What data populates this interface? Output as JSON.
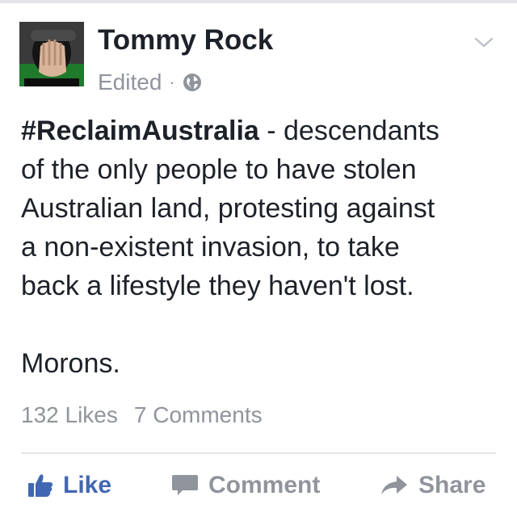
{
  "post": {
    "author": "Tommy Rock",
    "status": "Edited",
    "separator": "·",
    "privacy_icon": "globe-icon",
    "options_icon": "chevron-down-icon",
    "hashtag": "#ReclaimAustralia",
    "body_lines": [
      " - descendants",
      "of the only people to have stolen",
      "Australian land, protesting against",
      "a non-existent invasion, to take",
      "back a lifestyle they haven't lost."
    ],
    "closing": "Morons."
  },
  "stats": {
    "likes": "132 Likes",
    "comments": "7 Comments"
  },
  "actions": {
    "like_label": "Like",
    "comment_label": "Comment",
    "share_label": "Share"
  },
  "colors": {
    "text": "#1d2129",
    "muted": "#90949c",
    "accent": "#4267b2",
    "divider": "#e5e5e5"
  }
}
